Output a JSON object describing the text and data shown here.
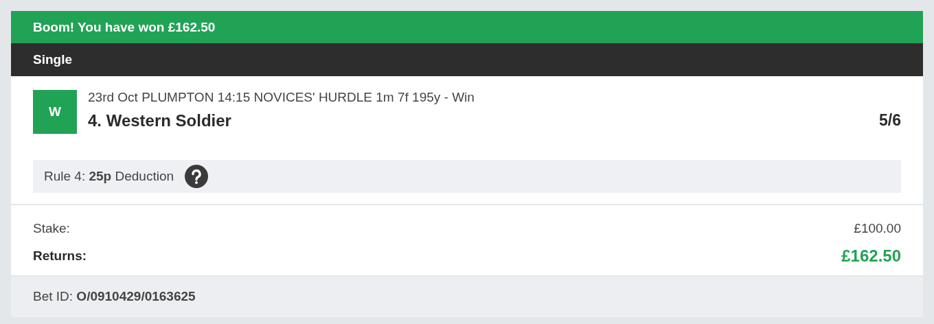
{
  "banner": {
    "text": "Boom! You have won £162.50"
  },
  "bet_type": "Single",
  "selection": {
    "result": "W",
    "event": "23rd Oct PLUMPTON 14:15 NOVICES' HURDLE 1m 7f 195y - Win",
    "runner": "4. Western Soldier",
    "odds": "5/6"
  },
  "rule4": {
    "text": "Rule 4: **25p** Deduction"
  },
  "stake": {
    "label": "Stake:",
    "value": "£100.00"
  },
  "returns": {
    "label": "Returns:",
    "value": "£162.50"
  },
  "bet_id": {
    "text": "Bet ID: **O/0910429/0163625**"
  }
}
